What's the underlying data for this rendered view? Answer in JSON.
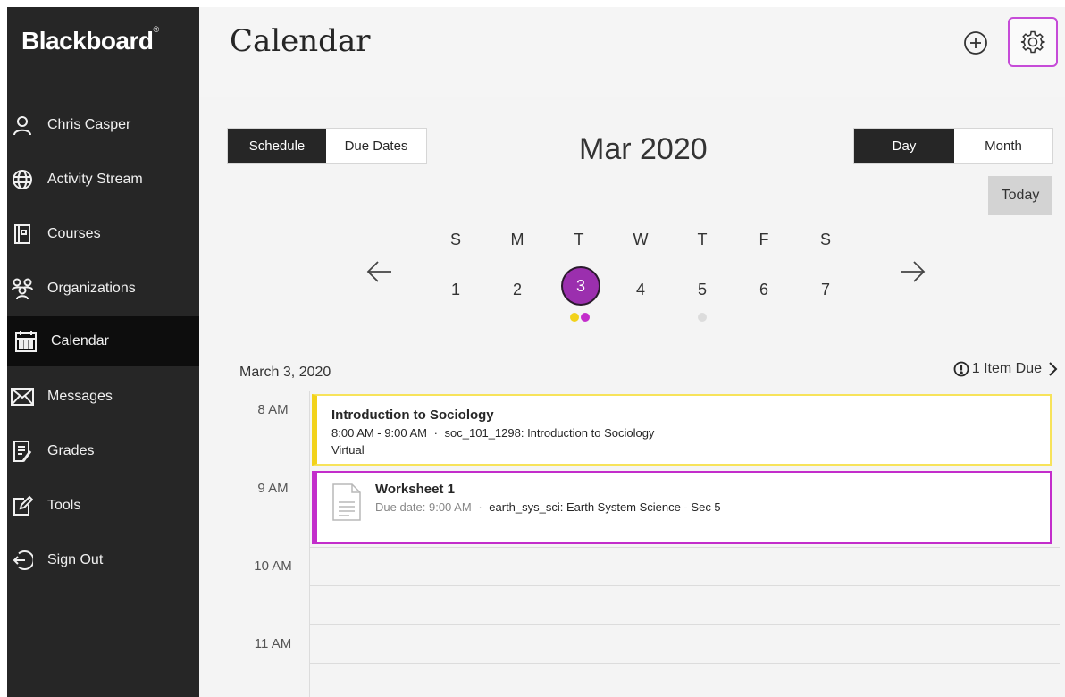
{
  "app": {
    "brand": "Blackboard",
    "brand_mark": "®"
  },
  "sidebar": {
    "items": [
      {
        "label": "Chris Casper",
        "icon": "user-icon"
      },
      {
        "label": "Activity Stream",
        "icon": "globe-icon"
      },
      {
        "label": "Courses",
        "icon": "courses-icon"
      },
      {
        "label": "Organizations",
        "icon": "organizations-icon"
      },
      {
        "label": "Calendar",
        "icon": "calendar-icon",
        "active": true
      },
      {
        "label": "Messages",
        "icon": "envelope-icon"
      },
      {
        "label": "Grades",
        "icon": "grades-icon"
      },
      {
        "label": "Tools",
        "icon": "tools-icon"
      },
      {
        "label": "Sign Out",
        "icon": "sign-out-icon"
      }
    ]
  },
  "header": {
    "title": "Calendar",
    "add_icon": "plus-circle-icon",
    "settings_icon": "gear-icon"
  },
  "view_toggle": {
    "schedule": "Schedule",
    "due_dates": "Due Dates",
    "active": "Schedule"
  },
  "range_toggle": {
    "day": "Day",
    "month": "Month",
    "active": "Day"
  },
  "month_title": "Mar 2020",
  "today_label": "Today",
  "week": {
    "letters": [
      "S",
      "M",
      "T",
      "W",
      "T",
      "F",
      "S"
    ],
    "numbers": [
      "1",
      "2",
      "3",
      "4",
      "5",
      "6",
      "7"
    ],
    "selected": "3",
    "prev_icon": "arrow-left-icon",
    "next_icon": "arrow-right-icon"
  },
  "day_header": {
    "date": "March 3, 2020",
    "due": "1 Item Due"
  },
  "times": [
    "8 AM",
    "9 AM",
    "10 AM",
    "11 AM"
  ],
  "events": [
    {
      "title": "Introduction to Sociology",
      "time": "8:00 AM - 9:00 AM",
      "separator": "·",
      "course": "soc_101_1298: Introduction to Sociology",
      "location": "Virtual"
    },
    {
      "title": "Worksheet 1",
      "due": "Due date: 9:00 AM",
      "separator": "·",
      "course": "earth_sys_sci: Earth System Science - Sec 5"
    }
  ],
  "colors": {
    "accent": "#9b2fae",
    "event_yellow": "#f2d21a",
    "event_purple": "#c32dcb",
    "sidebar": "#262626"
  }
}
